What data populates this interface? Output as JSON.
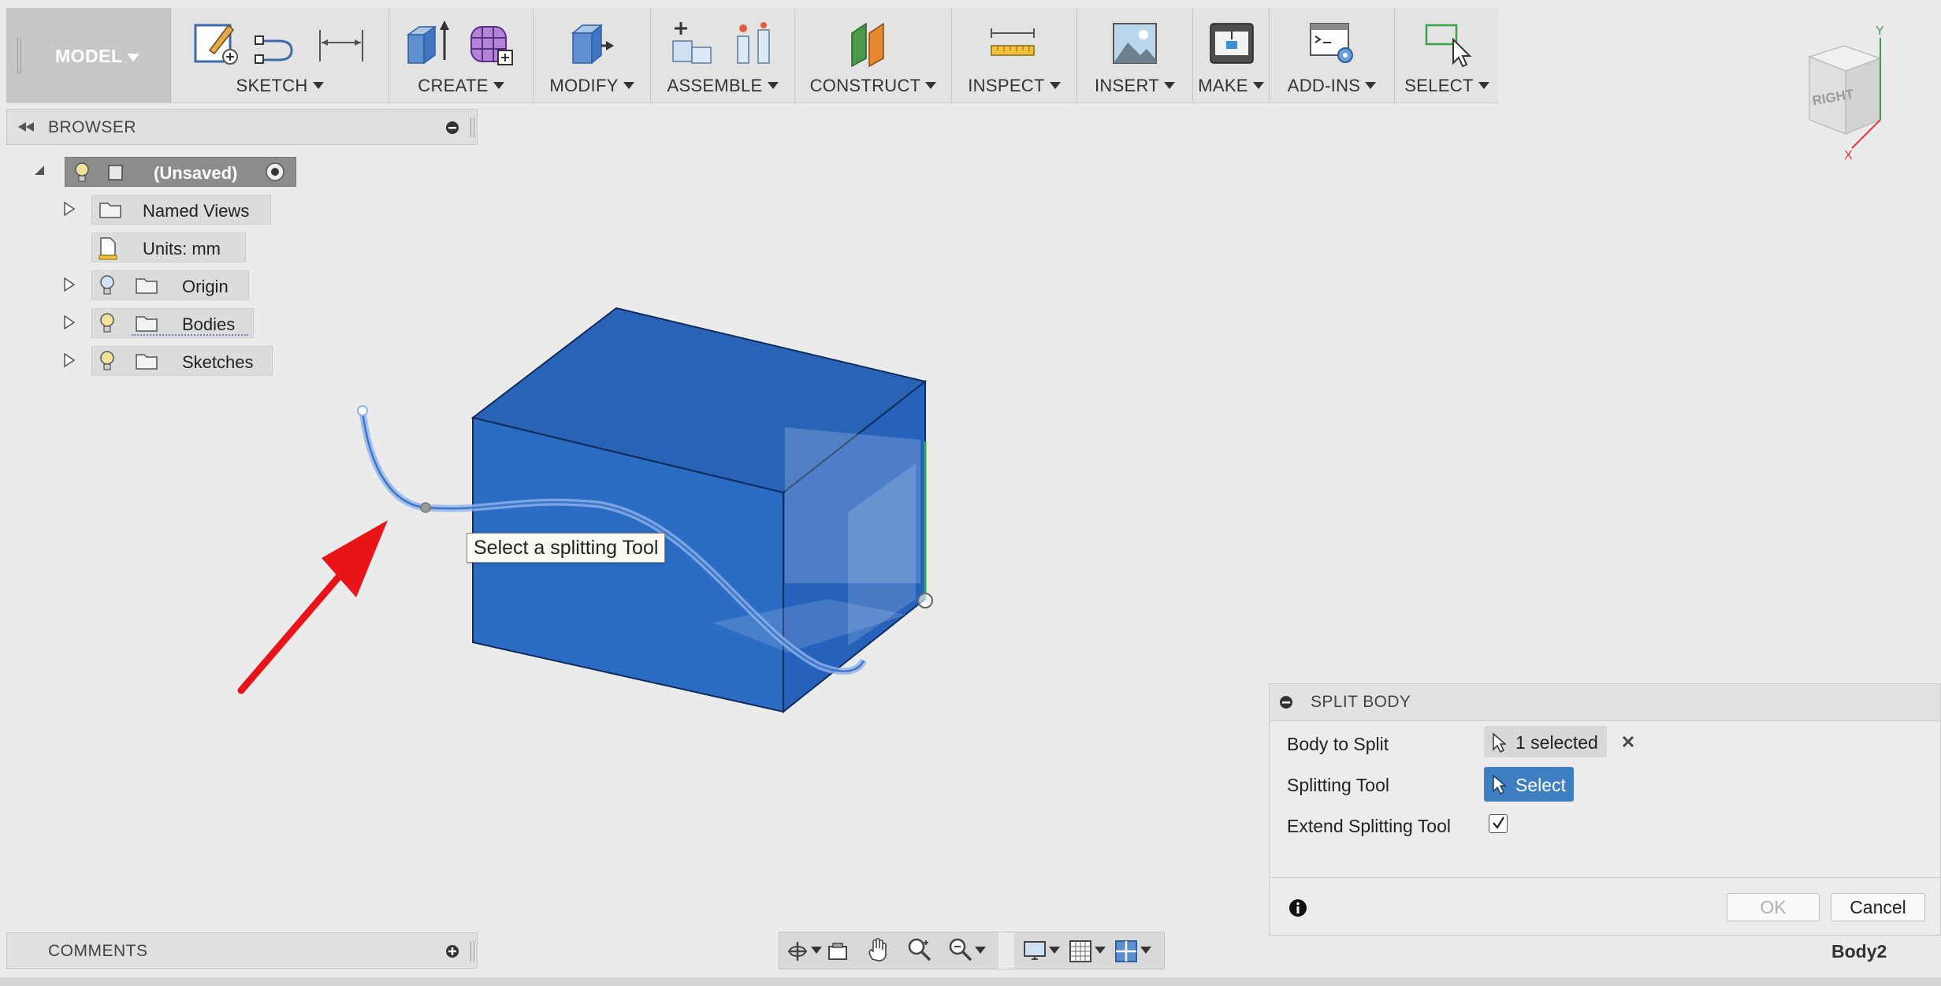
{
  "toolbar": {
    "workspace": "MODEL",
    "groups": [
      {
        "label": "SKETCH",
        "icons": [
          "create-sketch-icon",
          "line-icon",
          "dimension-icon"
        ]
      },
      {
        "label": "CREATE",
        "icons": [
          "extrude-icon",
          "form-icon"
        ]
      },
      {
        "label": "MODIFY",
        "icons": [
          "press-pull-icon"
        ]
      },
      {
        "label": "ASSEMBLE",
        "icons": [
          "new-component-icon",
          "joint-icon"
        ]
      },
      {
        "label": "CONSTRUCT",
        "icons": [
          "offset-plane-icon"
        ]
      },
      {
        "label": "INSPECT",
        "icons": [
          "measure-icon"
        ]
      },
      {
        "label": "INSERT",
        "icons": [
          "insert-image-icon"
        ]
      },
      {
        "label": "MAKE",
        "icons": [
          "3d-print-icon"
        ]
      },
      {
        "label": "ADD-INS",
        "icons": [
          "scripts-icon"
        ]
      },
      {
        "label": "SELECT",
        "icons": [
          "select-icon"
        ]
      }
    ]
  },
  "browser": {
    "title": "BROWSER",
    "root": "(Unsaved)",
    "items": [
      {
        "label": "Named Views"
      },
      {
        "label": "Units: mm"
      },
      {
        "label": "Origin"
      },
      {
        "label": "Bodies"
      },
      {
        "label": "Sketches"
      }
    ]
  },
  "comments": {
    "title": "COMMENTS"
  },
  "viewport": {
    "tooltip": "Select a splitting Tool",
    "viewcube_face": "RIGHT",
    "axis_x": "X",
    "axis_y": "Y",
    "colors": {
      "body": "#2b6cc4",
      "body_top": "#2a63b6",
      "body_side": "#1f56a8",
      "arrow": "#e8141a"
    }
  },
  "dialog": {
    "title": "SPLIT BODY",
    "body_to_split_label": "Body to Split",
    "body_to_split_value": "1 selected",
    "splitting_tool_label": "Splitting Tool",
    "splitting_tool_value": "Select",
    "extend_label": "Extend Splitting Tool",
    "extend_checked": true,
    "ok_label": "OK",
    "cancel_label": "Cancel"
  },
  "status": {
    "active_body": "Body2"
  }
}
